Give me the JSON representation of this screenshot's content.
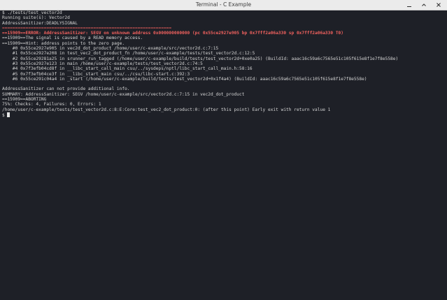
{
  "window": {
    "title": "Terminal - C Example",
    "controls": [
      {
        "name": "minimize-icon",
        "label": "minimize"
      },
      {
        "name": "maximize-icon",
        "label": "maximize"
      },
      {
        "name": "close-icon",
        "label": "close"
      }
    ]
  },
  "colors": {
    "background": "#1e2027",
    "text": "#d4d4d4",
    "error": "#f0615e",
    "titlebar": "#ebebeb"
  },
  "terminal": {
    "lines": [
      {
        "text": "$ ./tests/test_vector2d",
        "style": "normal"
      },
      {
        "text": "Running suite(s): Vector2d",
        "style": "normal"
      },
      {
        "text": "AddressSanitizer:DEADLYSIGNAL",
        "style": "normal"
      },
      {
        "text": "=================================================================",
        "style": "sep"
      },
      {
        "text": "==15909==ERROR: AddressSanitizer: SEGV on unknown address 0x000000000000 (pc 0x55ce2927e905 bp 0x7fff2a06a330 sp 0x7fff2a06a330 T0)",
        "style": "err"
      },
      {
        "text": "==15909==The signal is caused by a READ memory access.",
        "style": "normal"
      },
      {
        "text": "==15909==Hint: address points to the zero page.",
        "style": "normal"
      },
      {
        "text": "    #0 0x55ce2927e905 in vec2d_dot_product /home/user/c-example/src/vector2d.c:7:15",
        "style": "normal"
      },
      {
        "text": "    #1 0x55ce2927e208 in test_vec2_dot_product_fn /home/user/c-example/tests/test_vector2d.c:12:5",
        "style": "normal"
      },
      {
        "text": "    #2 0x55ce29281a25 in srunner_run_tagged (/home/user/c-example/build/tests/test_vector2d+0xe0a25) (BuildId: aaac16c59a6c7565e51c105f615e8f1e7f8e558e)",
        "style": "normal"
      },
      {
        "text": "    #3 0x55ce2927e123 in main /home/user/c-example/tests/test_vector2d.c:74:5",
        "style": "normal"
      },
      {
        "text": "    #4 0x7f3efb04cd8f in __libc_start_call_main csu/../sysdeps/nptl/libc_start_call_main.h:58:16",
        "style": "normal"
      },
      {
        "text": "    #5 0x7f3efb04ce3f in __libc_start_main csu/../csu/libc-start.c:392:3",
        "style": "normal"
      },
      {
        "text": "    #6 0x55ce291c04a4 in _start (/home/user/c-example/build/tests/test_vector2d+0x1f4a4) (BuildId: aaac16c59a6c7565e51c105f615e8f1e7f8e558e)",
        "style": "normal"
      },
      {
        "text": "",
        "style": "normal"
      },
      {
        "text": "AddressSanitizer can not provide additional info.",
        "style": "normal"
      },
      {
        "text": "SUMMARY: AddressSanitizer: SEGV /home/user/c-example/src/vector2d.c:7:15 in vec2d_dot_product",
        "style": "normal"
      },
      {
        "text": "==15909==ABORTING",
        "style": "normal"
      },
      {
        "text": "75%: Checks: 4, Failures: 0, Errors: 1",
        "style": "normal"
      },
      {
        "text": "/home/user/c-example/tests/test_vector2d.c:8:E:Core:test_vec2_dot_product:0: (after this point) Early exit with return value 1",
        "style": "normal"
      }
    ],
    "prompt": "$"
  }
}
